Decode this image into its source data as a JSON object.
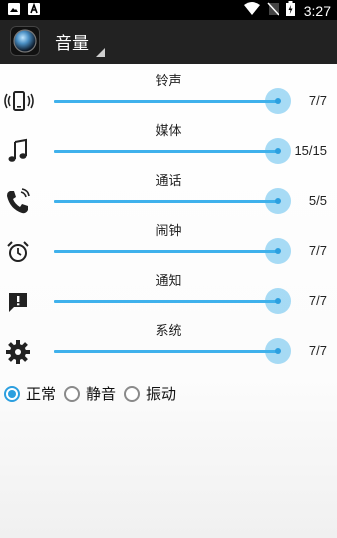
{
  "status_bar": {
    "time": "3:27",
    "icons": [
      "image-icon",
      "font-icon",
      "wifi-icon",
      "no-sim-icon",
      "battery-charging-icon"
    ]
  },
  "app_bar": {
    "title": "音量",
    "logo_icon": "app-logo-icon"
  },
  "volume_rows": [
    {
      "label": "铃声",
      "value": "7/7",
      "level": 1.0,
      "icon": "phone-ring-icon"
    },
    {
      "label": "媒体",
      "value": "15/15",
      "level": 1.0,
      "icon": "music-note-icon"
    },
    {
      "label": "通话",
      "value": "5/5",
      "level": 1.0,
      "icon": "phone-call-icon"
    },
    {
      "label": "闹钟",
      "value": "7/7",
      "level": 1.0,
      "icon": "alarm-clock-icon"
    },
    {
      "label": "通知",
      "value": "7/7",
      "level": 1.0,
      "icon": "notification-icon"
    },
    {
      "label": "系统",
      "value": "7/7",
      "level": 1.0,
      "icon": "gear-icon"
    }
  ],
  "ringer_modes": [
    {
      "label": "正常",
      "selected": true
    },
    {
      "label": "静音",
      "selected": false
    },
    {
      "label": "振动",
      "selected": false
    }
  ],
  "colors": {
    "accent": "#2c9fdf",
    "track": "#3fb1ec",
    "action_bar": "#222222"
  }
}
